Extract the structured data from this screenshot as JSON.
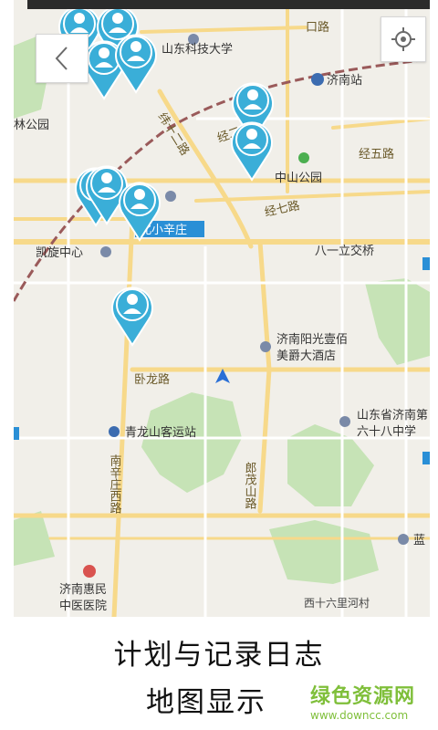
{
  "map": {
    "labels": {
      "shandong_univ_sci_tech": "山东科技大学",
      "jinan_station": "济南站",
      "linggong_park": "林公园",
      "weishi_road": "纬十二路",
      "jing_er_road": "经二",
      "jing_wu_road": "经五路",
      "zhongshan_park": "中山公园",
      "jing_qi_road": "经七路",
      "beixiaoxin": "北小辛庄",
      "kaixuan_center": "凯旋中心",
      "bayi_interchange": "八一立交桥",
      "hotel_line1": "济南阳光壹佰",
      "hotel_line2": "美爵大酒店",
      "wolong_road": "卧龙路",
      "shandong_68_line1": "山东省济南第",
      "shandong_68_line2": "六十八中学",
      "qinglongshan_station": "青龙山客运站",
      "langmao_road": "郎茂山路",
      "nanxinzhuang_west_road": "南辛庄西路",
      "hospital_line1": "济南惠民",
      "hospital_line2": "中医医院",
      "xishiliu_village": "西十六里河村",
      "top_road": "口路",
      "right_edge_lan": "蓝"
    },
    "pin_color": "#3aaed8",
    "pin_inner": "#ffffff",
    "route_color": "#2a8fd6"
  },
  "controls": {
    "back_icon": "chevron-left-icon",
    "locate_icon": "crosshair-icon"
  },
  "captions": {
    "line1": "计划与记录日志",
    "line2": "地图显示"
  },
  "watermark": {
    "title": "绿色资源网",
    "url": "www.downcc.com"
  }
}
